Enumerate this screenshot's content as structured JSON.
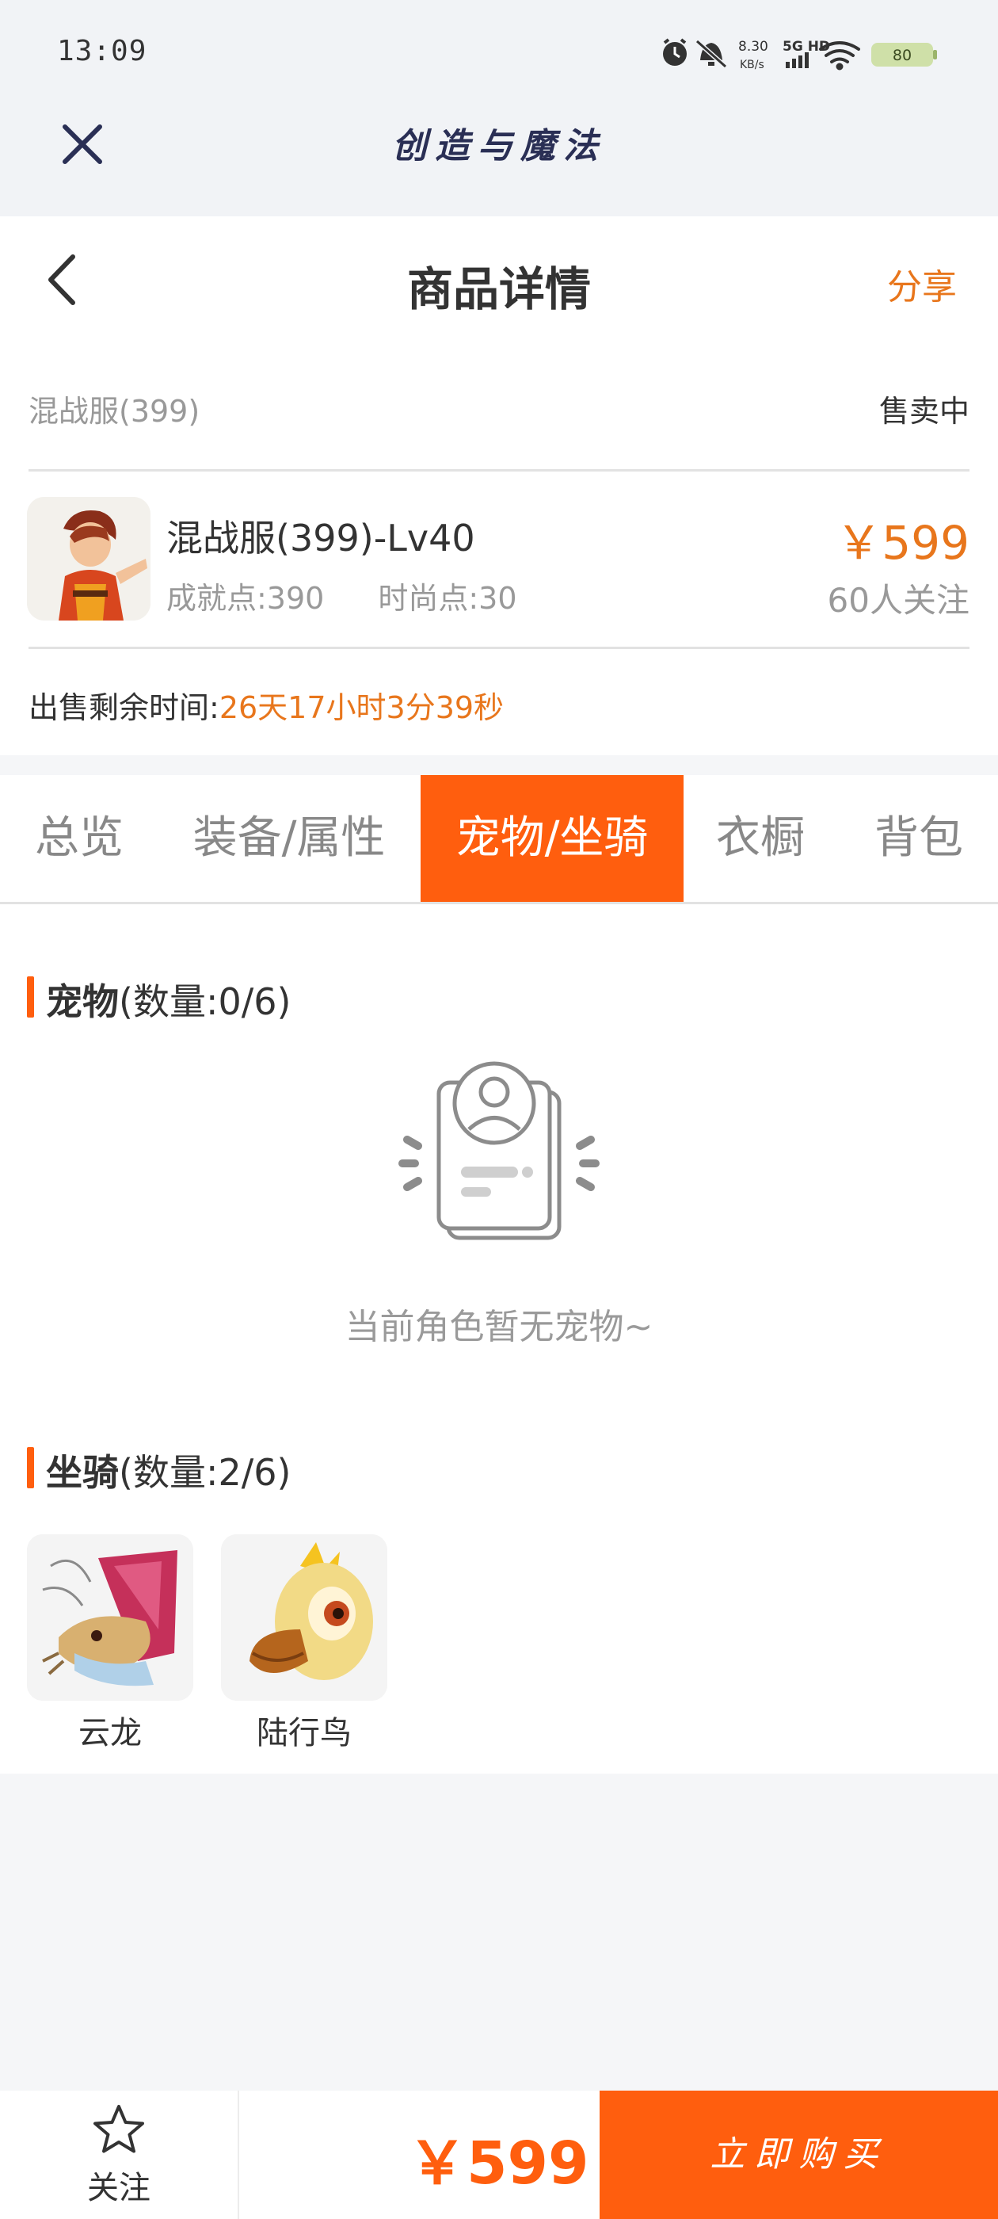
{
  "status_bar": {
    "time": "13:09",
    "net_speed": "8.30",
    "net_unit": "KB/s",
    "network": "5G HD",
    "battery": "80",
    "icons": [
      "alarm-icon",
      "mute-icon",
      "signal-icon",
      "wifi-icon",
      "battery-icon"
    ]
  },
  "app_bar": {
    "title": "创造与魔法",
    "close_icon": "close-icon"
  },
  "header": {
    "back_icon": "back-icon",
    "title": "商品详情",
    "share_label": "分享"
  },
  "item": {
    "server": "混战服(399)",
    "status": "售卖中",
    "name": "混战服(399)-Lv40",
    "achievement": "成就点:390",
    "fashion": "时尚点:30",
    "price": "￥599",
    "followers": "60人关注",
    "remain_label": "出售剩余时间:",
    "remain_value": "26天17小时3分39秒"
  },
  "tabs": [
    {
      "label": "总览",
      "active": false
    },
    {
      "label": "装备/属性",
      "active": false
    },
    {
      "label": "宠物/坐骑",
      "active": true
    },
    {
      "label": "衣橱",
      "active": false
    },
    {
      "label": "背包",
      "active": false
    }
  ],
  "pets": {
    "title": "宠物",
    "count": "(数量:0/6)",
    "empty_text": "当前角色暂无宠物~"
  },
  "mounts": {
    "title": "坐骑",
    "count": "(数量:2/6)",
    "items": [
      {
        "name": "云龙"
      },
      {
        "name": "陆行鸟"
      }
    ]
  },
  "bottom_bar": {
    "follow_label": "关注",
    "price": "￥599",
    "buy_label": "立即购买"
  },
  "colors": {
    "accent": "#ff5e0e",
    "price_orange": "#e8761c",
    "title_navy": "#2a2f55"
  }
}
